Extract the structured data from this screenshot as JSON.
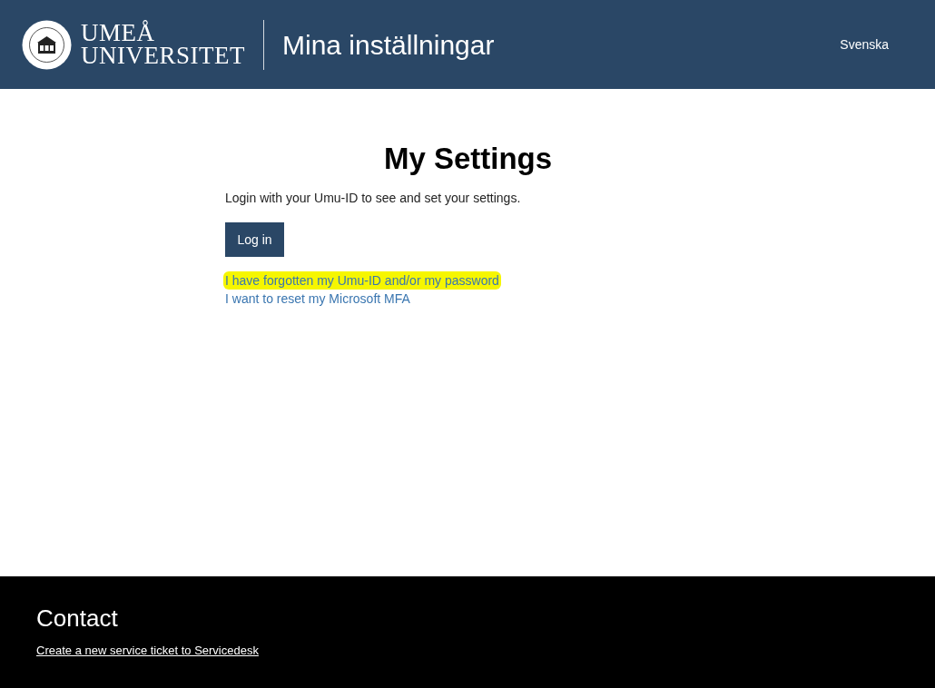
{
  "header": {
    "logo_text": [
      "UMEÅ",
      "UNIVERSITET"
    ],
    "title": "Mina inställningar",
    "language_link": "Svenska"
  },
  "main": {
    "heading": "My Settings",
    "intro": "Login with your Umu-ID to see and set your settings.",
    "login_button": "Log in",
    "links": [
      {
        "label": "I have forgotten my Umu-ID and/or my password",
        "highlighted": true
      },
      {
        "label": "I want to reset my Microsoft MFA",
        "highlighted": false
      }
    ]
  },
  "footer": {
    "heading": "Contact",
    "link": "Create a new service ticket to Servicedesk"
  }
}
